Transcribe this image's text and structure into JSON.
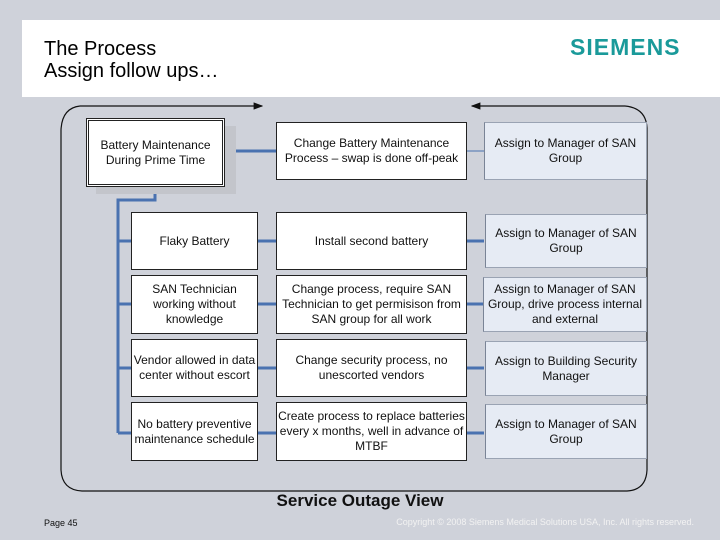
{
  "header": {
    "title_line1": "The Process",
    "title_line2": "Assign follow ups…",
    "logo": "SIEMENS",
    "logo_color": "#1a9a9a"
  },
  "diagram": {
    "root": {
      "label": "Battery Maintenance During Prime Time"
    },
    "rows": [
      {
        "cause": "Battery Maintenance During Prime Time",
        "action": "Change  Battery Maintenance Process – swap is done off-peak",
        "owner": "Assign to Manager of SAN Group"
      },
      {
        "cause": "Flaky Battery",
        "action": "Install second battery",
        "owner": "Assign to Manager of SAN Group"
      },
      {
        "cause": "SAN Technician working without knowledge",
        "action": "Change process, require SAN Technician to get permisison from SAN group for all work",
        "owner": "Assign to Manager of SAN Group, drive process internal and external"
      },
      {
        "cause": "Vendor allowed in data center without escort",
        "action": "Change security process, no unescorted vendors",
        "owner": "Assign to Building Security Manager"
      },
      {
        "cause": "No battery preventive maintenance schedule",
        "action": "Create process to replace batteries every x months, well in advance of MTBF",
        "owner": "Assign to Manager of SAN Group"
      }
    ],
    "connector_color": "#4a72b0",
    "view_label": "Service Outage View"
  },
  "footer": {
    "page": "Page 45",
    "copyright": "Copyright © 2008 Siemens Medical Solutions USA, Inc. All rights reserved."
  }
}
